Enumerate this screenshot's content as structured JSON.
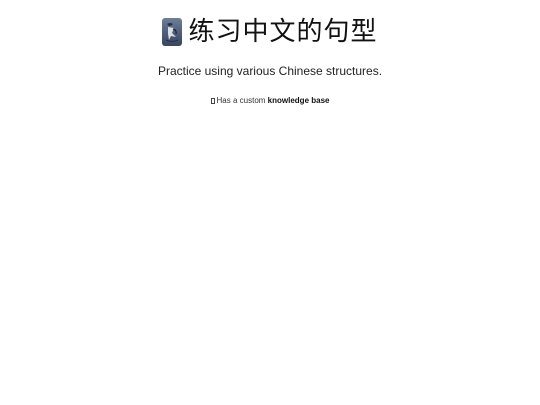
{
  "header": {
    "logo_icon": "ink-figure-logo-icon",
    "title": "练习中文的句型"
  },
  "subtitle": "Practice using various Chinese structures.",
  "knowledge": {
    "icon": "missing-glyph-icon",
    "prefix": "Has a custom",
    "link_text": "knowledge base"
  },
  "colors": {
    "background": "#ffffff",
    "text": "#111111",
    "logo_dark": "#384660",
    "logo_light": "#6e7f99"
  }
}
